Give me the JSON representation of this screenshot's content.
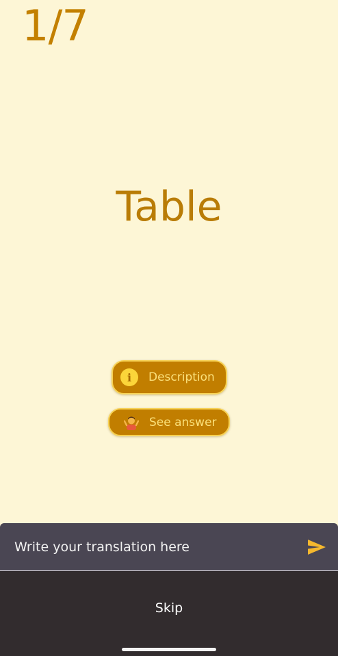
{
  "progress": {
    "current": 1,
    "total": 7,
    "label": "1/7"
  },
  "word": "Table",
  "buttons": {
    "description": {
      "label": "Description",
      "icon": "info-icon"
    },
    "see_answer": {
      "label": "See answer",
      "icon": "shrug-icon"
    }
  },
  "translation_input": {
    "placeholder": "Write your translation here",
    "value": "",
    "send_icon": "send-icon"
  },
  "skip_label": "Skip",
  "colors": {
    "background": "#fdf6d6",
    "accent": "#c17e00",
    "accent_text": "#fbe17b",
    "input_bar": "#4a4653",
    "bottom_bar": "#322c2e"
  }
}
